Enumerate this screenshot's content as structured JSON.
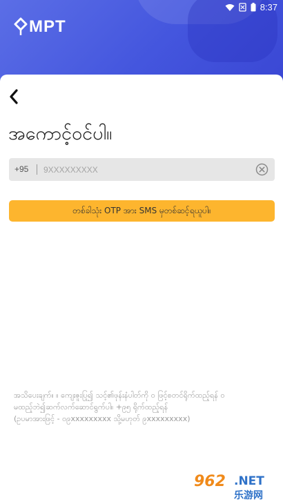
{
  "status_bar": {
    "time": "8:37",
    "icons": [
      "wifi-icon",
      "sim-off-icon",
      "battery-icon"
    ]
  },
  "brand": {
    "name": "MPT",
    "header_color": "#4456de"
  },
  "page": {
    "title": "အကောင့်ဝင်ပါ။"
  },
  "phone": {
    "country_code": "+95",
    "placeholder": "9XXXXXXXXX",
    "value": ""
  },
  "otp_button": {
    "label": "တစ်ခါသုံး OTP အား SMS မှတစ်ဆင့်ရယူပါ။",
    "color": "#fdb52e"
  },
  "footer": {
    "line1": "အသိပေးချက်။ ။ ကျေးဇူးပြု၍ သင့်၏ဖုန်းနံပါတ်ကို ၀ ဖြင့်စတင်ရိုက်ထည့်ရန် ၀",
    "line2": "မထည့်ဘဲ၍ဆက်လက်ဆောင်ရွက်ပါ။ +၉၅ ရိုက်ထည့်ရန်",
    "line3": "(ဥပမာအားဖြင့် - ၀၉xxxxxxxxx သို့မဟုတ် ၉xxxxxxxxx)"
  },
  "watermark": {
    "number": "962",
    "domain": ".NET",
    "site": "乐游网"
  }
}
